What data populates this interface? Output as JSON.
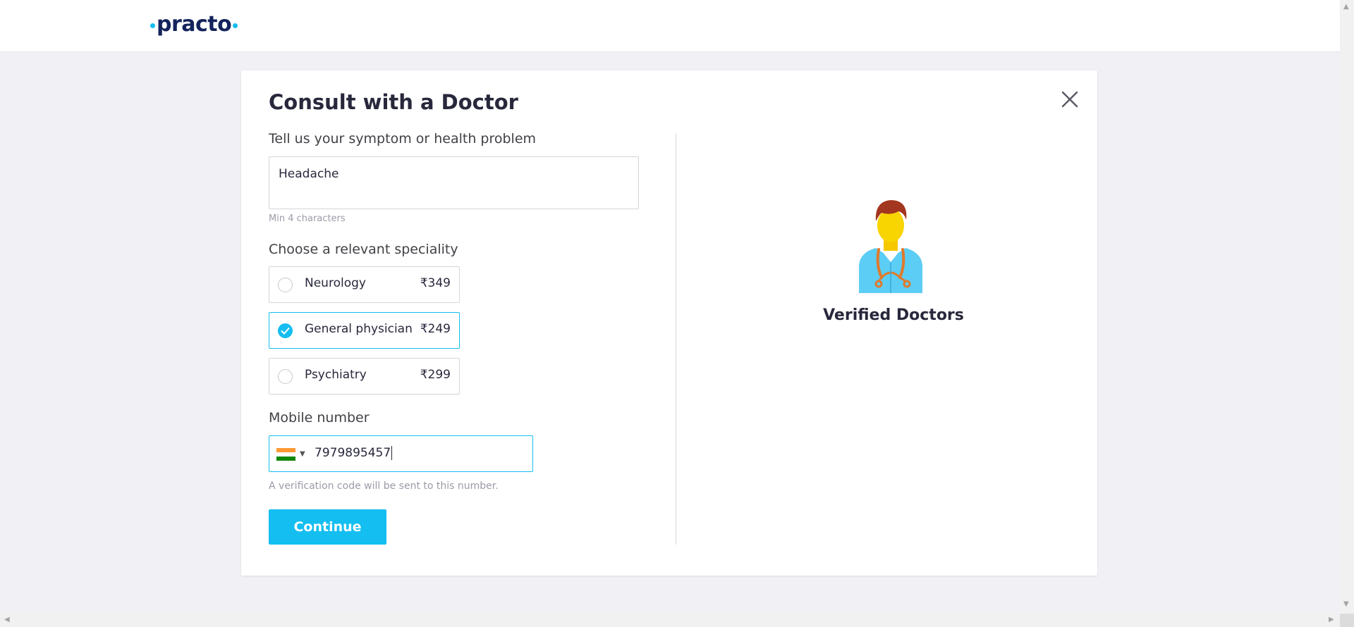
{
  "header": {
    "logo_text": "practo"
  },
  "card": {
    "title": "Consult with a Doctor",
    "close_icon": "close-icon"
  },
  "symptom": {
    "label": "Tell us your symptom or health problem",
    "value": "Headache",
    "hint": "Min 4 characters"
  },
  "speciality": {
    "label": "Choose a relevant speciality",
    "options": [
      {
        "name": "Neurology",
        "price": "₹349",
        "selected": false
      },
      {
        "name": "General physician",
        "price": "₹249",
        "selected": true
      },
      {
        "name": "Psychiatry",
        "price": "₹299",
        "selected": false
      }
    ]
  },
  "mobile": {
    "label": "Mobile number",
    "country_icon": "india-flag-icon",
    "value": "7979895457",
    "hint": "A verification code will be sent to this number."
  },
  "actions": {
    "continue_label": "Continue"
  },
  "right_panel": {
    "illustration_icon": "doctor-illustration-icon",
    "caption": "Verified Doctors"
  },
  "colors": {
    "accent": "#14bef0",
    "brand_navy": "#14235b",
    "flag_saffron": "#ff9933",
    "flag_green": "#138808"
  }
}
